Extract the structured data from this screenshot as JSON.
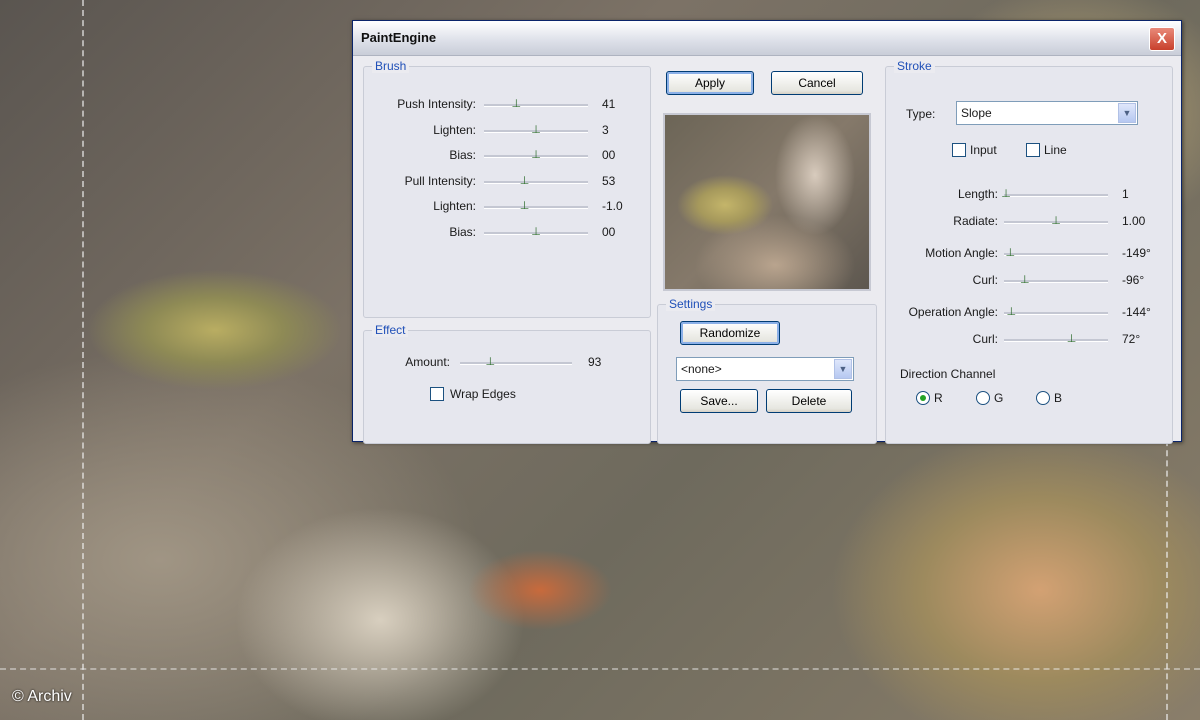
{
  "background": {
    "credit": "© Archiv"
  },
  "dialog": {
    "title": "PaintEngine",
    "close_label": "X",
    "apply_label": "Apply",
    "cancel_label": "Cancel",
    "brush": {
      "legend": "Brush",
      "rows": [
        {
          "label": "Push Intensity:",
          "value": "41",
          "level": 0.31
        },
        {
          "label": "Lighten:",
          "value": "3",
          "level": 0.5
        },
        {
          "label": "Bias:",
          "value": "00",
          "level": 0.5
        },
        {
          "label": "Pull Intensity:",
          "value": "53",
          "level": 0.39
        },
        {
          "label": "Lighten:",
          "value": "-1.0",
          "level": 0.39
        },
        {
          "label": "Bias:",
          "value": "00",
          "level": 0.5
        }
      ]
    },
    "effect": {
      "legend": "Effect",
      "amount_label": "Amount:",
      "amount_value": "93",
      "amount_level": 0.27,
      "wrap_edges_label": "Wrap Edges"
    },
    "settings": {
      "legend": "Settings",
      "randomize_label": "Randomize",
      "preset_value": "<none>",
      "save_label": "Save...",
      "delete_label": "Delete"
    },
    "stroke": {
      "legend": "Stroke",
      "type_label": "Type:",
      "type_value": "Slope",
      "input_label": "Input",
      "line_label": "Line",
      "rows": [
        {
          "label": "Length:",
          "value": "1",
          "level": 0.02
        },
        {
          "label": "Radiate:",
          "value": "1.00",
          "level": 0.5
        },
        {
          "label": "Motion Angle:",
          "value": "-149°",
          "level": 0.06
        },
        {
          "label": "Curl:",
          "value": "-96°",
          "level": 0.2
        },
        {
          "label": "Operation Angle:",
          "value": "-144°",
          "level": 0.07
        },
        {
          "label": "Curl:",
          "value": "72°",
          "level": 0.65
        }
      ],
      "direction_label": "Direction Channel",
      "channels": [
        {
          "label": "R",
          "selected": true
        },
        {
          "label": "G",
          "selected": false
        },
        {
          "label": "B",
          "selected": false
        }
      ]
    }
  }
}
